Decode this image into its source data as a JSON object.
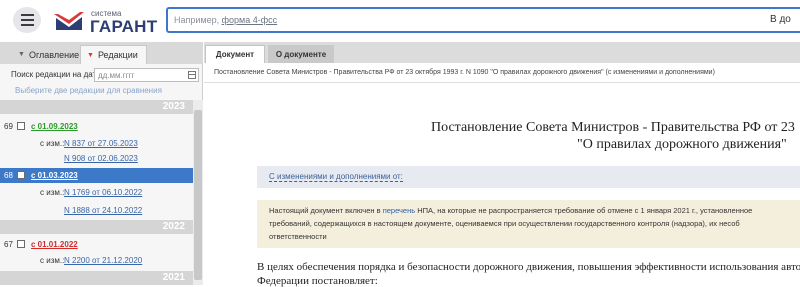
{
  "header": {
    "logo_small": "система",
    "logo_big": "ГАРАНТ",
    "search_placeholder_prefix": "Например, ",
    "search_placeholder_example": "форма 4-фсс",
    "search_scope": "В до"
  },
  "left_panel": {
    "tabs": [
      {
        "label": "Оглавление",
        "icon": "triangle-down-gray-icon",
        "active": false
      },
      {
        "label": "Редакции",
        "icon": "triangle-down-red-icon",
        "active": true
      }
    ],
    "date_search_label": "Поиск редакции на дату",
    "date_placeholder": "дд.мм.гггг",
    "compare_hint": "Выберите две редакции для сравнения",
    "years": [
      "2023",
      "2022",
      "2021"
    ],
    "revisions": [
      {
        "num": "69",
        "date": "с 01.09.2023",
        "color": "#2c9a2c",
        "selected": false,
        "changes": [
          "N 837 от 27.05.2023",
          "N 908 от 02.06.2023"
        ]
      },
      {
        "num": "68",
        "date": "с 01.03.2023",
        "color": "#ffffff",
        "selected": true,
        "changes": [
          "N 1769 от 06.10.2022",
          "N 1888 от 24.10.2022"
        ]
      },
      {
        "num": "67",
        "date": "с 01.01.2022",
        "color": "#d22c2c",
        "selected": false,
        "changes": [
          "N 2200 от 21.12.2020"
        ]
      }
    ],
    "change_prefix": "с изм.:"
  },
  "document": {
    "tabs": [
      {
        "label": "Документ",
        "active": true
      },
      {
        "label": "О документе",
        "active": false
      }
    ],
    "path": "Постановление Совета Министров - Правительства РФ от 23 октября 1993 г. N 1090 \"О правилах дорожного движения\" (с изменениями и дополнениями)",
    "title_line1": "Постановление Совета Министров - Правительства РФ от 23",
    "title_line2": "\"О правилах дорожного движения\"",
    "changes_link": "С изменениями и дополнениями от:",
    "notice_line1_pre": "Настоящий документ включен в ",
    "notice_line1_link": "перечень",
    "notice_line1_post": " НПА, на которые не распространяется требование об отмене с 1 января 2021 г., установленное",
    "notice_line2": "требований, содержащихся в настоящем документе, оцениваемся при осуществлении государственного контроля (надзора), их несоб",
    "notice_line3": "ответственности",
    "body_line1": "В целях обеспечения порядка и безопасности дорожного движения, повышения эффективности использования автом",
    "body_line2": "Федерации постановляет:"
  }
}
